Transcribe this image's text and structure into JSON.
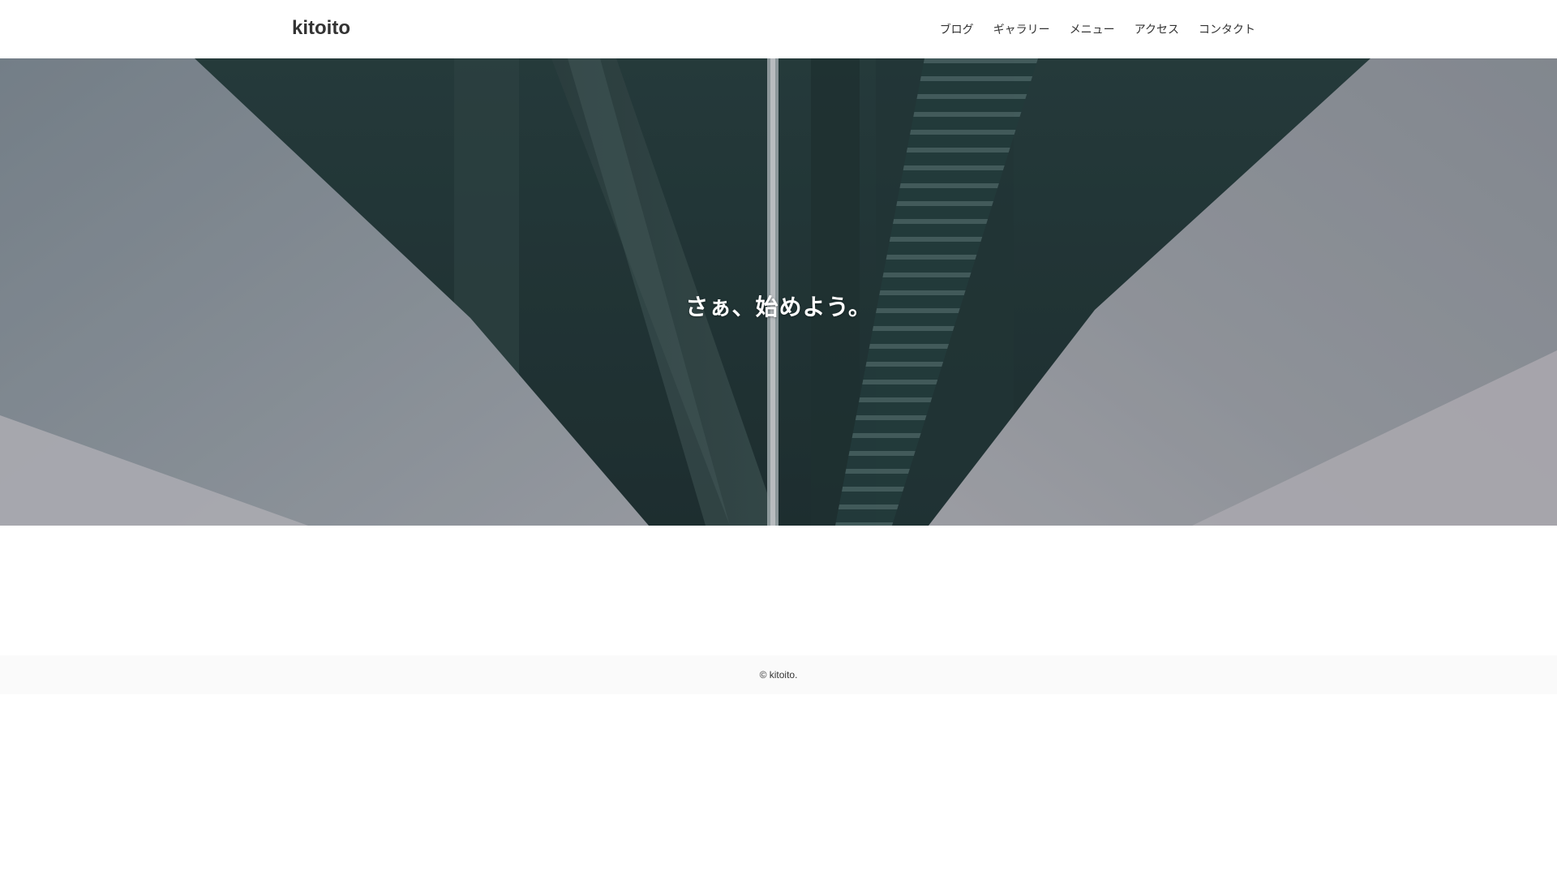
{
  "header": {
    "logo": "kitoito",
    "nav": [
      {
        "label": "ブログ"
      },
      {
        "label": "ギャラリー"
      },
      {
        "label": "メニュー"
      },
      {
        "label": "アクセス"
      },
      {
        "label": "コンタクト"
      }
    ]
  },
  "hero": {
    "title": "さぁ、始めよう。",
    "image": "concrete-bridge-underside-photo"
  },
  "footer": {
    "copyright": "© kitoito."
  },
  "colors": {
    "text": "#333333",
    "hero_text": "#ffffff",
    "footer_bg": "#fafafa"
  }
}
